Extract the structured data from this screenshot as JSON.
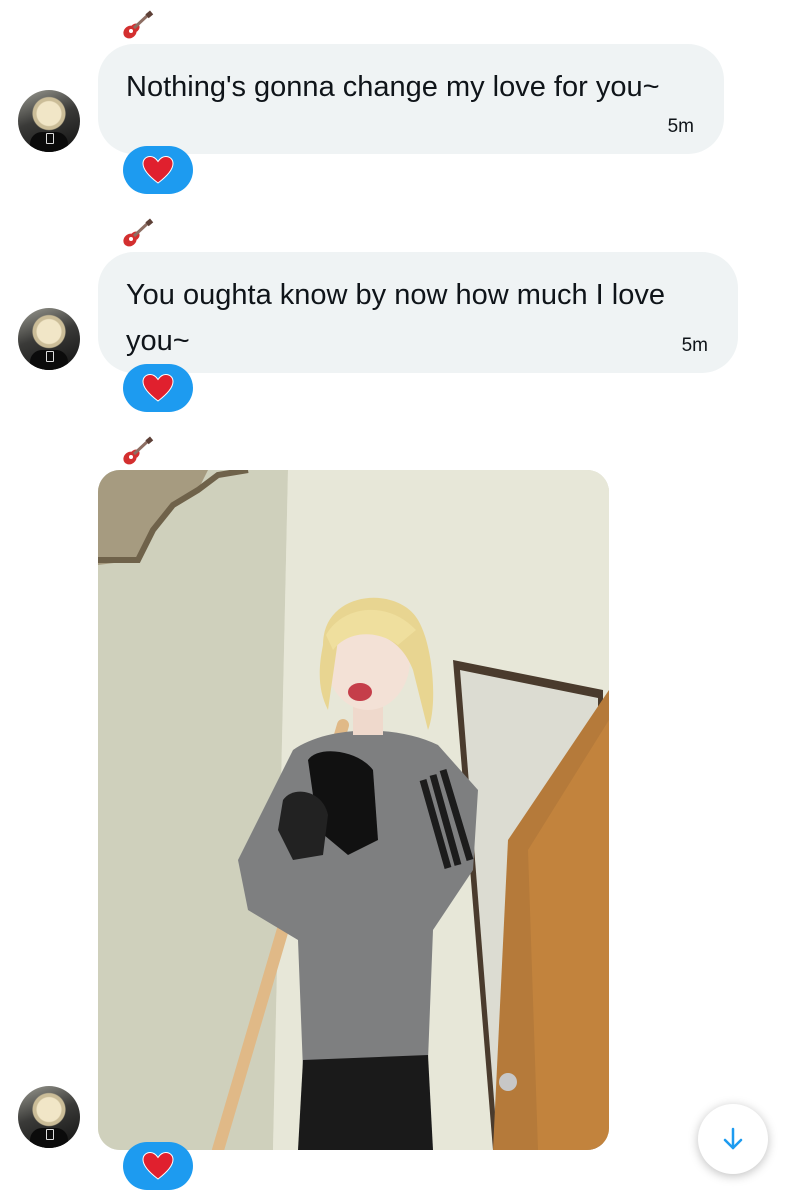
{
  "conversation": {
    "messages": [
      {
        "text": "Nothing's gonna change my love for you~",
        "time": "5m",
        "reaction": "heart",
        "reaction_emoji": "❤️",
        "sender_emoji": "🎸"
      },
      {
        "text": "You oughta know by now how much I love you~",
        "time": "5m",
        "reaction": "heart",
        "reaction_emoji": "❤️",
        "sender_emoji": "🎸"
      },
      {
        "type": "image",
        "reaction": "heart",
        "reaction_emoji": "❤️",
        "sender_emoji": "🎸"
      }
    ]
  },
  "scroll_to_bottom": {
    "icon": "arrow-down-icon"
  },
  "colors": {
    "bubble": "#eff3f4",
    "reaction": "#1d9bf0",
    "accent": "#1d9bf0"
  }
}
